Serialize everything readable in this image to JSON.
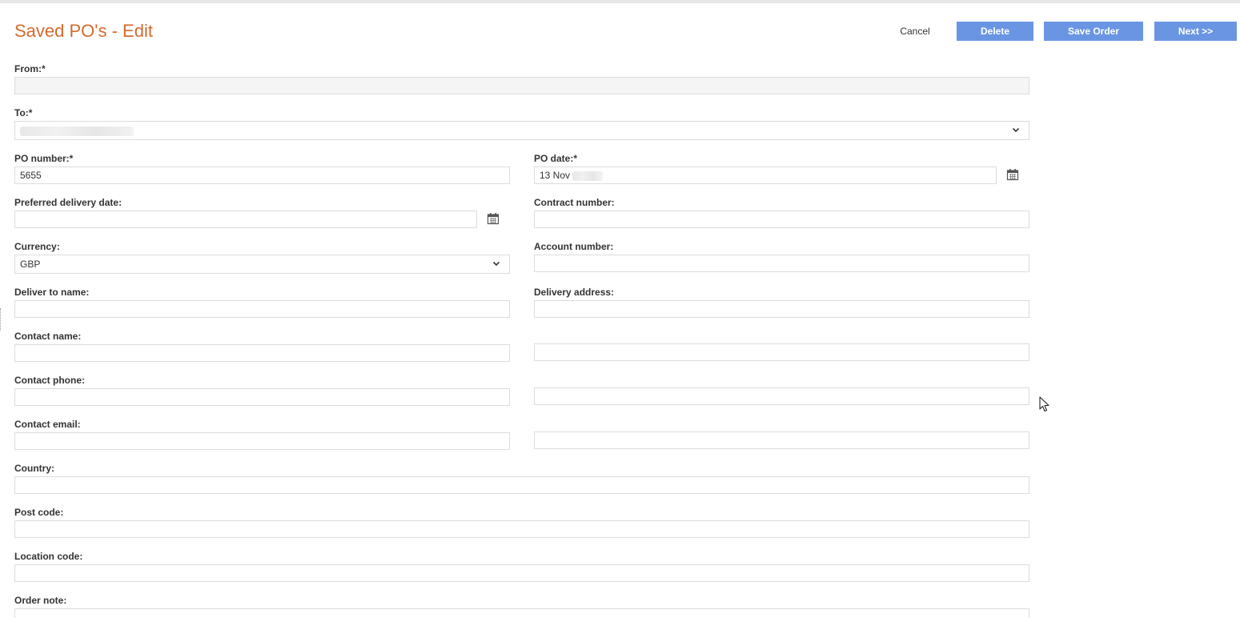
{
  "page": {
    "title": "Saved PO's - Edit"
  },
  "toolbar": {
    "cancel_label": "Cancel",
    "delete_label": "Delete",
    "save_label": "Save Order",
    "next_label": "Next >>"
  },
  "form": {
    "from": {
      "label": "From:*",
      "value": ""
    },
    "to": {
      "label": "To:*",
      "value": ""
    },
    "po_number": {
      "label": "PO number:*",
      "value": "5655"
    },
    "po_date": {
      "label": "PO date:*",
      "value": "13 Nov"
    },
    "preferred_delivery_date": {
      "label": "Preferred delivery date:",
      "value": ""
    },
    "contract_number": {
      "label": "Contract number:",
      "value": ""
    },
    "currency": {
      "label": "Currency:",
      "value": "GBP"
    },
    "account_number": {
      "label": "Account number:",
      "value": ""
    },
    "deliver_to_name": {
      "label": "Deliver to name:",
      "value": ""
    },
    "delivery_address": {
      "label": "Delivery address:",
      "lines": [
        "",
        "",
        "",
        ""
      ]
    },
    "contact_name": {
      "label": "Contact name:",
      "value": ""
    },
    "contact_phone": {
      "label": "Contact phone:",
      "value": ""
    },
    "contact_email": {
      "label": "Contact email:",
      "value": ""
    },
    "country": {
      "label": "Country:",
      "value": ""
    },
    "post_code": {
      "label": "Post code:",
      "value": ""
    },
    "location_code": {
      "label": "Location code:",
      "value": ""
    },
    "order_note": {
      "label": "Order note:",
      "value": ""
    }
  },
  "icons": {
    "calendar": "calendar-icon",
    "chevron": "chevron-down-icon",
    "cursor": "mouse-pointer-icon"
  },
  "colors": {
    "title": "#d46a2e",
    "primary_button": "#6a95e3",
    "field_border": "#dcdcdc"
  }
}
